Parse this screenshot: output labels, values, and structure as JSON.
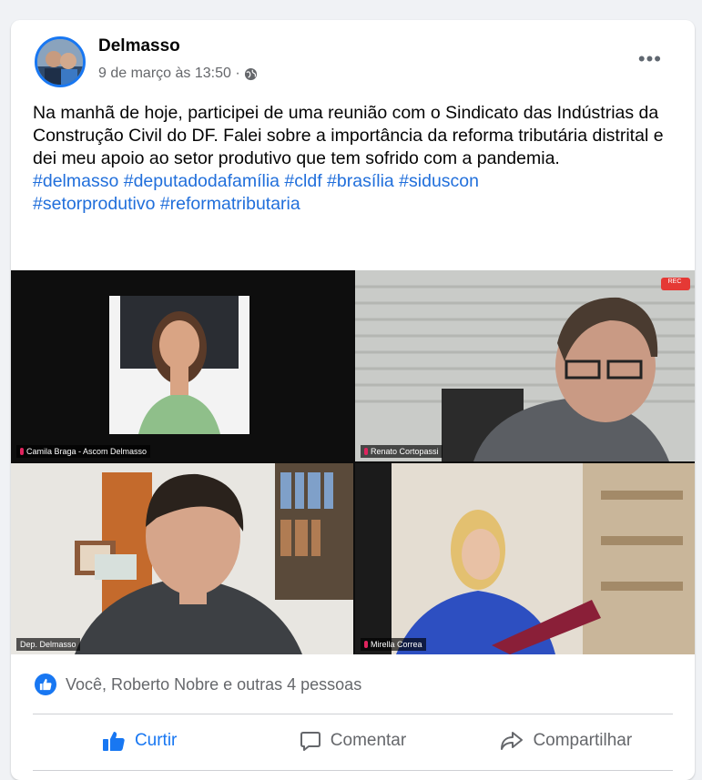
{
  "post": {
    "author": "Delmasso",
    "timestamp": "9 de março às 13:50 ·",
    "privacy_icon": "globe-icon",
    "more_label": "•••",
    "text": "Na manhã de hoje, participei de uma reunião com o Sindicato das Indústrias da Construção Civil do DF. Falei sobre a importância da reforma tributária distrital e dei meu apoio ao setor produtivo que tem sofrido com a pandemia.",
    "hashtags_line1": "#delmasso #deputadodafamília #cldf #brasília #siduscon",
    "hashtags_line2": "#setorprodutivo #reformatributaria"
  },
  "video_call": {
    "participants": [
      {
        "name": "Camila Braga - Ascom Delmasso"
      },
      {
        "name": "Renato Cortopassi"
      },
      {
        "name": "Dep. Delmasso"
      },
      {
        "name": "Mirella Correa"
      }
    ],
    "rec_label": "REC"
  },
  "reactions": {
    "icon": "like-icon",
    "summary": "Você, Roberto Nobre e outras 4 pessoas"
  },
  "actions": {
    "like_label": "Curtir",
    "comment_label": "Comentar",
    "share_label": "Compartilhar"
  },
  "colors": {
    "accent": "#1877f2",
    "hashtag": "#216fdb",
    "active_speaker_border": "#31c254"
  }
}
